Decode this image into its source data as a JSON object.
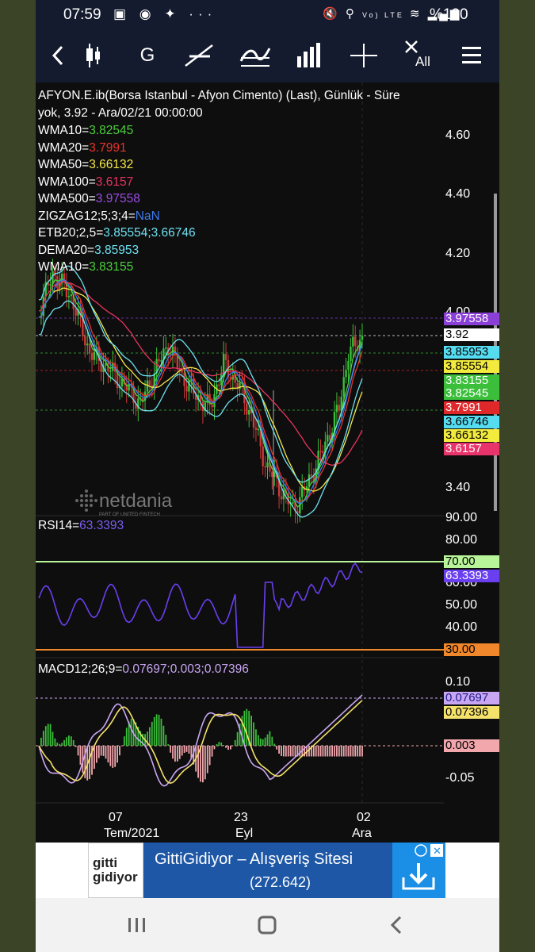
{
  "status": {
    "time": "07:59",
    "carrier": "Vo) LTE",
    "battery": "%100"
  },
  "toolbar": {
    "g_label": "G",
    "all_label": "All"
  },
  "chart": {
    "header_line1": "AFYON.E.ib(Borsa Istanbul - Afyon Cimento) (Last),  Günlük - Süre",
    "header_line2": "yok, 3.92 - Ara/02/21 00:00:00",
    "indicators": [
      {
        "name": "WMA10=",
        "value": "3.82545",
        "color": "#4ccf3c"
      },
      {
        "name": "WMA20=",
        "value": "3.7991",
        "color": "#e8332a"
      },
      {
        "name": "WMA50=",
        "value": "3.66132",
        "color": "#f5e84a"
      },
      {
        "name": "WMA100=",
        "value": "3.6157",
        "color": "#e8335e"
      },
      {
        "name": "WMA500=",
        "value": "3.97558",
        "color": "#9b4ce6"
      },
      {
        "name": "ZIGZAG12;5;3;4=",
        "value": "NaN",
        "color": "#3d7bf0"
      },
      {
        "name": "ETB20;2,5=",
        "value": "3.85554;3.66746",
        "color": "#6ee0f0"
      },
      {
        "name": "DEMA20=",
        "value": "3.85953",
        "color": "#6ee0f0"
      },
      {
        "name": "WMA10=",
        "value": "3.83155",
        "color": "#4ccf3c"
      }
    ],
    "price_axis": [
      "4.60",
      "4.40",
      "4.20",
      "4.00",
      "3.40"
    ],
    "price_tags": [
      {
        "value": "3.97558",
        "bg": "#8a3fd6",
        "fg": "#ffffff"
      },
      {
        "value": "3.92",
        "bg": "#ffffff",
        "fg": "#000000"
      },
      {
        "value": "3.85953",
        "bg": "#55dcf0",
        "fg": "#000000"
      },
      {
        "value": "3.85554",
        "bg": "#f2ea3c",
        "fg": "#000000"
      },
      {
        "value": "3.83155",
        "bg": "#3bbf3b",
        "fg": "#ffffff"
      },
      {
        "value": "3.82545",
        "bg": "#3bbf3b",
        "fg": "#ffffff"
      },
      {
        "value": "3.7991",
        "bg": "#e0282a",
        "fg": "#ffffff"
      },
      {
        "value": "3.66746",
        "bg": "#55dcf0",
        "fg": "#000000"
      },
      {
        "value": "3.66132",
        "bg": "#f2ea3c",
        "fg": "#000000"
      },
      {
        "value": "3.6157",
        "bg": "#e8336b",
        "fg": "#ffffff"
      }
    ],
    "watermark": "netdania",
    "watermark_sub": "PART OF UNITED FINTECH",
    "rsi": {
      "label": "RSI14=",
      "value": "63.3393",
      "axis": [
        "90.00",
        "80.00",
        "60.00",
        "50.00",
        "40.00"
      ],
      "tag_70": "70.00",
      "tag_value": "63.3393",
      "tag_30": "30.00"
    },
    "macd": {
      "label": "MACD12;26;9=",
      "value": "0.07697;0.003;0.07396",
      "axis": [
        "0.10",
        "-0.05"
      ],
      "tag_macd": "0.07697",
      "tag_signal": "0.07396",
      "tag_hist": "0.003"
    },
    "x_axis": [
      {
        "day": "07",
        "month": "Tem/2021"
      },
      {
        "day": "23",
        "month": "Eyl"
      },
      {
        "day": "02",
        "month": "Ara"
      }
    ]
  },
  "ad": {
    "logo_line1": "gitti",
    "logo_line2": "gidiyor",
    "title": "GittiGidiyor – Alışveriş Sitesi",
    "subtitle": "(272.642)"
  },
  "colors": {
    "bg": "#0e0e0e",
    "toolbar": "#141b2e",
    "rsi_line": "#6a3ff0",
    "macd_line": "#c9a6f2",
    "signal_line": "#f5e26b"
  }
}
